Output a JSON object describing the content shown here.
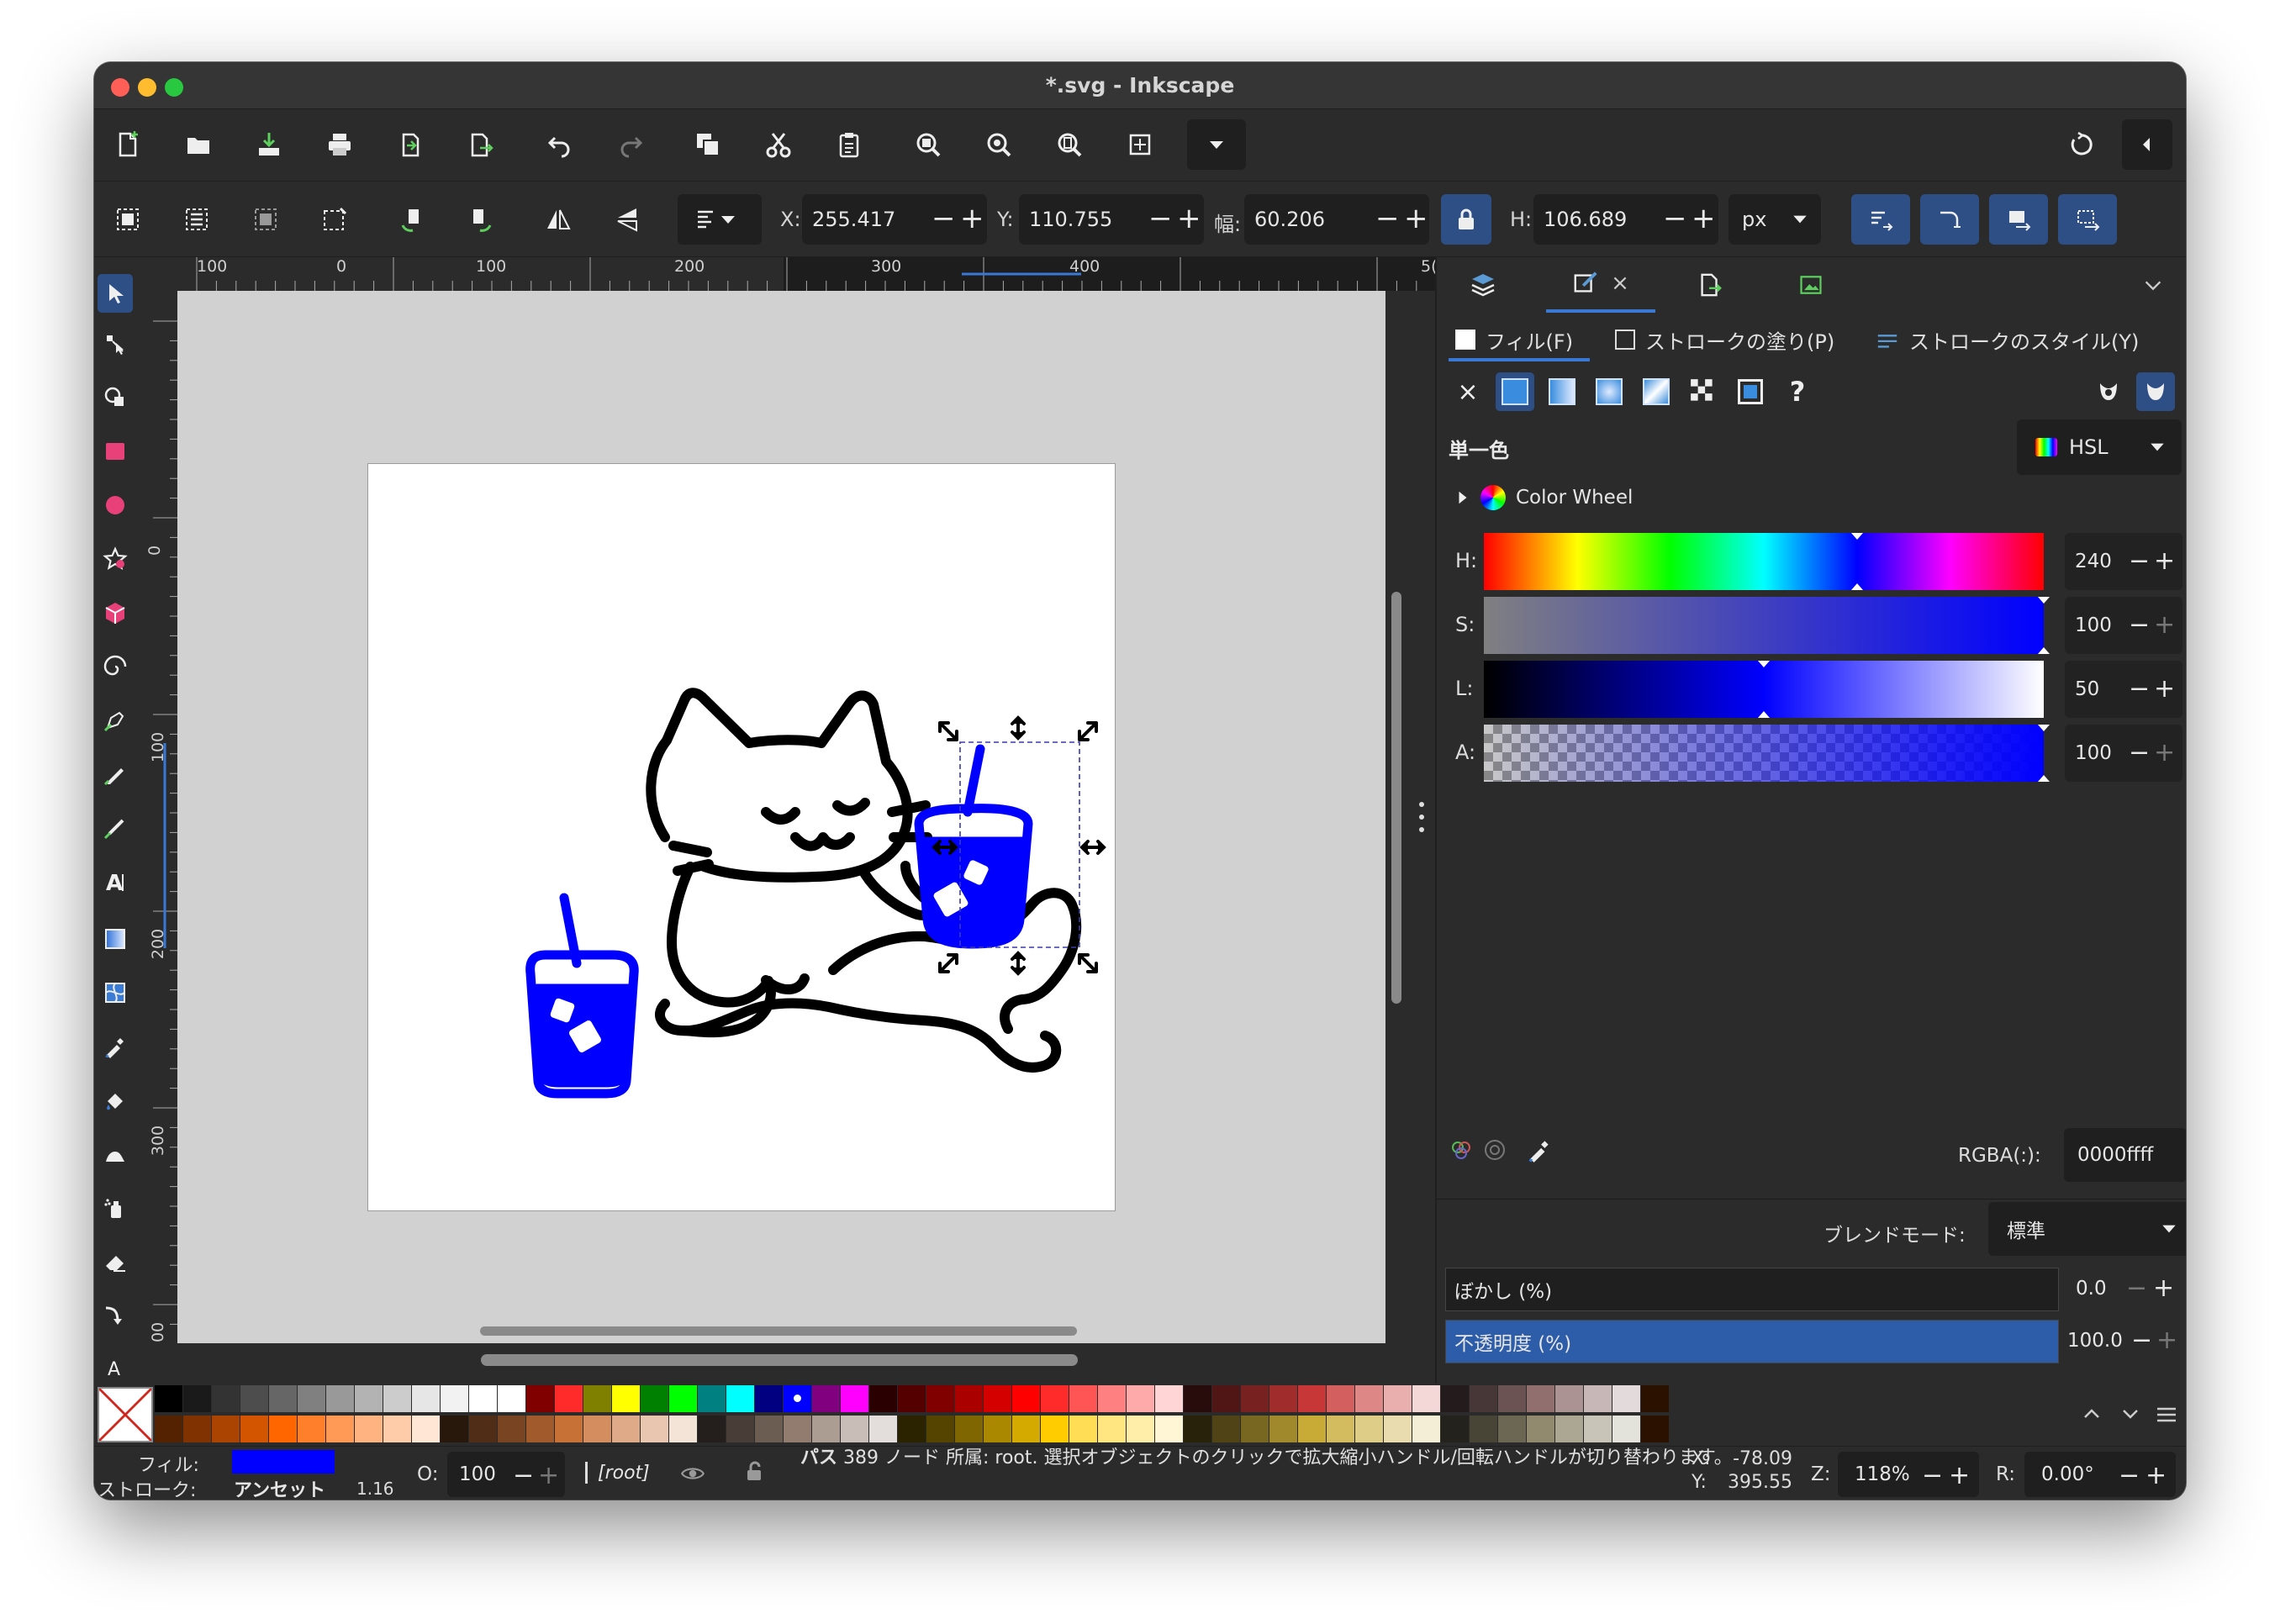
{
  "window": {
    "title": "*.svg - Inkscape",
    "traffic_lights": {
      "close": "#ff5f57",
      "minimize": "#febc2e",
      "zoom": "#28c840"
    }
  },
  "commands_bar": {
    "icons": [
      "new-document-icon",
      "open-icon",
      "import-icon",
      "print-icon",
      "duplicate-icon",
      "export-icon",
      "undo-icon",
      "redo-icon",
      "copy-icon",
      "cut-icon",
      "paste-icon",
      "zoom-selection-icon",
      "zoom-drawing-icon",
      "zoom-page-icon",
      "zoom-center-icon",
      "more-icon"
    ],
    "right_icons": [
      "sync-icon",
      "collapse-icon"
    ]
  },
  "tool_controls": {
    "x_label": "X:",
    "x_value": "255.417",
    "y_label": "Y:",
    "y_value": "110.755",
    "w_label": "幅:",
    "w_value": "60.206",
    "h_label": "H:",
    "h_value": "106.689",
    "unit": "px"
  },
  "rulers": {
    "horizontal_labels": [
      "100",
      "0",
      "100",
      "200",
      "300",
      "400",
      "5("
    ],
    "vertical_labels": [
      "0",
      "100",
      "200",
      "300",
      "400"
    ]
  },
  "toolbox": {
    "tools": [
      "selector-tool-icon",
      "node-tool-icon",
      "shape-builder-icon",
      "rectangle-tool-icon",
      "ellipse-tool-icon",
      "star-tool-icon",
      "box3d-tool-icon",
      "spiral-tool-icon",
      "pen-tool-icon",
      "pencil-tool-icon",
      "calligraphy-tool-icon",
      "text-tool-icon",
      "gradient-tool-icon",
      "mesh-tool-icon",
      "dropper-tool-icon",
      "paint-bucket-icon",
      "tweak-tool-icon",
      "spray-tool-icon",
      "eraser-tool-icon",
      "connector-tool-icon",
      "measure-tool-icon"
    ]
  },
  "fill_stroke": {
    "tabs": [
      "フィル(F)",
      "ストロークの塗り(P)",
      "ストロークのスタイル(Y)"
    ],
    "section_label": "単一色",
    "color_model": "HSL",
    "color_wheel_label": "Color Wheel",
    "sliders": [
      {
        "label": "H:",
        "value": "240",
        "position": 0.667
      },
      {
        "label": "S:",
        "value": "100",
        "position": 1.0
      },
      {
        "label": "L:",
        "value": "50",
        "position": 0.5
      },
      {
        "label": "A:",
        "value": "100",
        "position": 1.0
      }
    ],
    "rgba_label": "RGBA(:):",
    "rgba_value": "0000ffff",
    "blend_label": "ブレンドモード:",
    "blend_value": "標準",
    "blur_label": "ぼかし (%)",
    "blur_value": "0.0",
    "opacity_label": "不透明度 (%)",
    "opacity_value": "100.0",
    "opacity_fraction": 1.0
  },
  "palette": {
    "row1": [
      "#000000",
      "#1a1a1a",
      "#333333",
      "#4d4d4d",
      "#666666",
      "#808080",
      "#999999",
      "#b3b3b3",
      "#cccccc",
      "#e6e6e6",
      "#f2f2f2",
      "#ffffff",
      "#ffffff",
      "#800000",
      "#ff2a2a",
      "#808000",
      "#ffff00",
      "#008000",
      "#00ff00",
      "#008080",
      "#00ffff",
      "#000080",
      "#0000ff",
      "#800080",
      "#ff00ff",
      "#2b0000",
      "#550000",
      "#800000",
      "#aa0000",
      "#d40000",
      "#ff0000",
      "#ff2a2a",
      "#ff5555",
      "#ff8080",
      "#ffaaaa",
      "#ffd5d5",
      "#280b0b",
      "#501616",
      "#782121",
      "#a02c2c",
      "#c83737",
      "#d35f5f",
      "#de8787",
      "#e9afaf",
      "#f4d7d7",
      "#241c1c",
      "#483737",
      "#6c5353",
      "#916f6f",
      "#ac9393",
      "#c8b7b7",
      "#e3dbdb",
      "#2b1100"
    ],
    "row2": [
      "#552200",
      "#803300",
      "#aa4400",
      "#d45500",
      "#ff6600",
      "#ff7f2a",
      "#ff9955",
      "#ffb380",
      "#ffccaa",
      "#ffe6d5",
      "#28170b",
      "#502d16",
      "#784421",
      "#a05a2c",
      "#c87137",
      "#d38d5f",
      "#deaa87",
      "#e9c6af",
      "#f4e3d7",
      "#241f1c",
      "#483e37",
      "#6c5d53",
      "#917c6f",
      "#ac9d93",
      "#c8beb7",
      "#e3dedb",
      "#2b2200",
      "#554400",
      "#806600",
      "#aa8800",
      "#d4aa00",
      "#ffcc00",
      "#ffdd55",
      "#ffe680",
      "#ffeeaa",
      "#fff6d5",
      "#28220b",
      "#504416",
      "#786721",
      "#a0892c",
      "#c8ab37",
      "#d3bc5f",
      "#decd87",
      "#e9ddaf",
      "#f4eed7",
      "#24221c",
      "#484537",
      "#6c6753",
      "#918a6f",
      "#aca793",
      "#c8c4b7",
      "#e3e2db",
      "#2b1100"
    ]
  },
  "status": {
    "fill_label": "フィル:",
    "fill_color": "#0000ff",
    "stroke_label": "ストローク:",
    "stroke_value": "アンセット",
    "stroke_width": "1.16",
    "opacity_label": "O:",
    "opacity_value": "100",
    "layer": "[root]",
    "message_bold": "パス",
    "message": "389 ノード 所属: root. 選択オブジェクトのクリックで拡大縮小ハンドル/回転ハンドルが切り替わります。",
    "x_label": "X:",
    "x_value": "-78.09",
    "y_label": "Y:",
    "y_value": "395.55",
    "zoom_label": "Z:",
    "zoom_value": "118%",
    "rotate_label": "R:",
    "rotate_value": "0.00°"
  },
  "drawing": {
    "stroke_color": "#000000",
    "accent_color": "#0000ff"
  }
}
